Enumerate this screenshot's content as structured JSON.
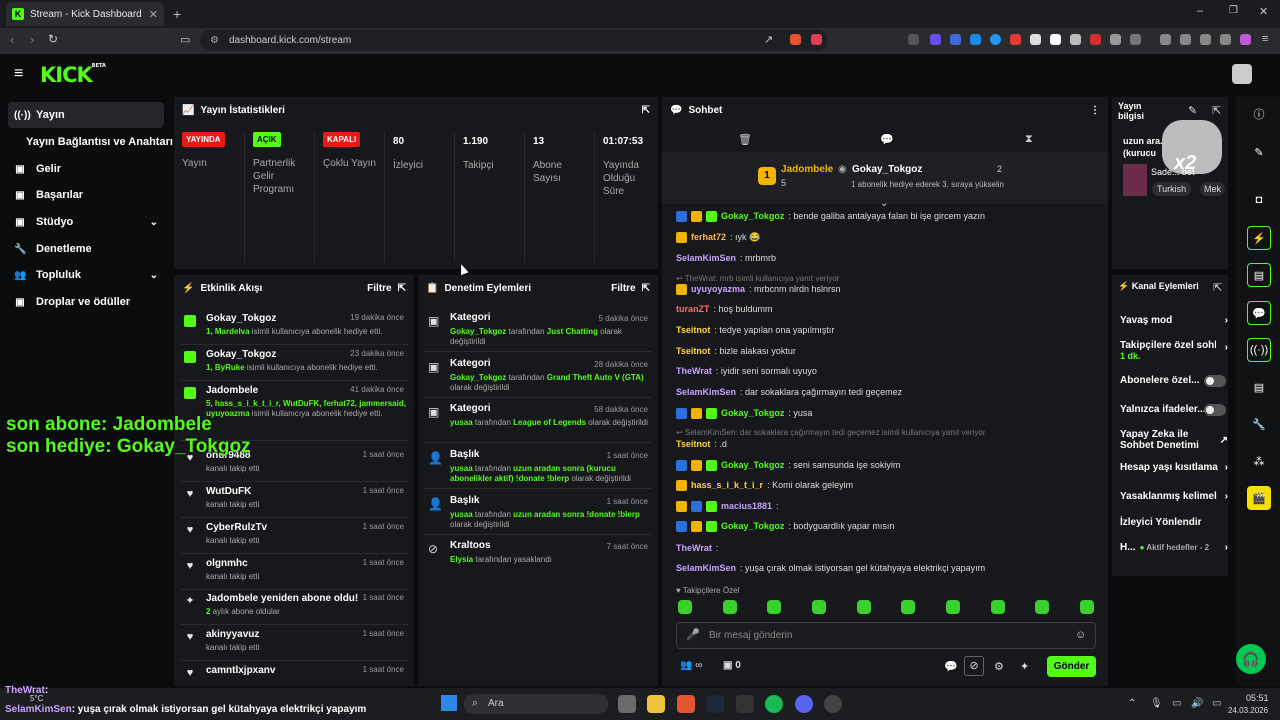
{
  "browser": {
    "tab_title": "Stream - Kick Dashboard",
    "url": "dashboard.kick.com/stream"
  },
  "brand": {
    "logo": "KICK",
    "beta": "BETA",
    "accent": "#53fc18"
  },
  "sidebar": {
    "items": [
      {
        "label": "Yayın",
        "icon": "broadcast-icon"
      },
      {
        "label": "Yayın Bağlantısı ve Anahtarı",
        "icon": ""
      },
      {
        "label": "Gelir",
        "icon": "dollar-icon"
      },
      {
        "label": "Başarılar",
        "icon": "trophy-icon"
      },
      {
        "label": "Stüdyo",
        "icon": "studio-icon"
      },
      {
        "label": "Denetleme",
        "icon": "wrench-icon"
      },
      {
        "label": "Topluluk",
        "icon": "users-icon"
      },
      {
        "label": "Droplar ve ödüller",
        "icon": "gift-icon"
      }
    ]
  },
  "stats": {
    "title": "Yayın İstatistikleri",
    "items": [
      {
        "badge": "YAYINDA",
        "label": "Yayın"
      },
      {
        "badge": "AÇIK",
        "label": "Partnerlik Gelir Programı"
      },
      {
        "badge": "KAPALI",
        "label": "Çoklu Yayın"
      },
      {
        "value": "80",
        "label": "İzleyici"
      },
      {
        "value": "1.190",
        "label": "Takipçi"
      },
      {
        "value": "13",
        "label": "Abone Sayısı"
      },
      {
        "value": "01:07:53",
        "label": "Yayında Olduğu Süre"
      }
    ]
  },
  "activity": {
    "title": "Etkinlik Akışı",
    "filter": "Filtre",
    "rows": [
      {
        "name": "Gokay_Tokgoz",
        "sub_hi": "1, Mardelva",
        "sub": " isimli kullanıcıya abonelik hediye etti.",
        "time": "19 dakika önce"
      },
      {
        "name": "Gokay_Tokgoz",
        "sub_hi": "1, ByRuke",
        "sub": " isimli kullanıcıya abonelik hediye etti.",
        "time": "23 dakika önce"
      },
      {
        "name": "Jadombele",
        "sub_hi": "5, hass_s_i_k_t_i_r, WutDuFK, ferhat72, jammersaid, uyuyoazma",
        "sub": " isimli kullanıcıya abonelik hediye etti.",
        "time": "41 dakika önce"
      },
      {
        "name": "onur9488",
        "sub_hi": "",
        "sub": "kanalı takip etti",
        "time": "1 saat önce"
      },
      {
        "name": "WutDuFK",
        "sub_hi": "",
        "sub": "kanalı takip etti",
        "time": "1 saat önce"
      },
      {
        "name": "CyberRulzTv",
        "sub_hi": "",
        "sub": "kanalı takip etti",
        "time": "1 saat önce"
      },
      {
        "name": "olgnmhc",
        "sub_hi": "",
        "sub": "kanalı takip etti",
        "time": "1 saat önce"
      },
      {
        "name": "Jadombele yeniden abone oldu!",
        "sub_hi": "2",
        "sub": " aylık abone oldular",
        "time": "1 saat önce"
      },
      {
        "name": "akinyyavuz",
        "sub_hi": "",
        "sub": "kanalı takip etti",
        "time": "1 saat önce"
      },
      {
        "name": "camntlxjpxanv",
        "sub_hi": "",
        "sub": "",
        "time": "1 saat önce"
      }
    ]
  },
  "moderation": {
    "title": "Denetim Eylemleri",
    "filter": "Filtre",
    "rows": [
      {
        "name": "Kategori",
        "actor": "Gokay_Tokgoz",
        "mid": " tarafından ",
        "target": "Just Chatting",
        "end": " olarak değiştirildi",
        "time": "5 dakika önce"
      },
      {
        "name": "Kategori",
        "actor": "Gokay_Tokgoz",
        "mid": " tarafından ",
        "target": "Grand Theft Auto V (GTA)",
        "end": " olarak değiştirildi",
        "time": "28 dakika önce"
      },
      {
        "name": "Kategori",
        "actor": "yusaa",
        "mid": " tarafından ",
        "target": "League of Legends",
        "end": " olarak değiştirildi",
        "time": "58 dakika önce"
      },
      {
        "name": "Başlık",
        "actor": "yusaa",
        "mid": " tarafından ",
        "target": "uzun aradan sonra (kurucu abonelikler aktif) !donate !blerp",
        "end": " olarak değiştirildi",
        "time": "1 saat önce"
      },
      {
        "name": "Başlık",
        "actor": "yusaa",
        "mid": " tarafından ",
        "target": "uzun aradan sonra !donate !blerp",
        "end": " olarak değiştirildi",
        "time": "1 saat önce"
      },
      {
        "name": "Kraltoos",
        "actor": "Elysia",
        "mid": " tarafından yasaklandı",
        "target": "",
        "end": "",
        "time": "7 saat önce"
      }
    ]
  },
  "chat": {
    "title": "Sohbet",
    "pinned": {
      "rank": "1",
      "user": "Jadombele",
      "count": "5",
      "gifter": "Gokay_Tokgoz",
      "gifter_count": "2",
      "note": "1 abonelik hediye ederek 3. sıraya yükselin"
    },
    "messages": [
      {
        "user": "Gokay_Tokgoz",
        "color": "#53fc18",
        "text": ": bende galiba antalyaya falan bi işe gircem yazın"
      },
      {
        "user": "ferhat72",
        "color": "#ffb84d",
        "text": ": ıyk 😂"
      },
      {
        "user": "SelamKimSen",
        "color": "#c8a2ff",
        "text": ": mrbmrb"
      },
      {
        "reply": "TheWrat: mrb isimli kullanıcıya yanıt veriyor"
      },
      {
        "user": "uyuyoyazma",
        "color": "#c8a2ff",
        "text": ": mrbcnm nlrdn hslnrsn"
      },
      {
        "user": "turanZT",
        "color": "#ff6b6b",
        "text": ": hoş buldumm"
      },
      {
        "user": "Tseitnot",
        "color": "#ffd23d",
        "text": ": tedye yapılan ona yapılmıştır"
      },
      {
        "user": "Tseitnot",
        "color": "#ffd23d",
        "text": ": bizle alakası yoktur"
      },
      {
        "user": "TheWrat",
        "color": "#c8a2ff",
        "text": ": iyidir seni sormalı uyuyo"
      },
      {
        "user": "SelamKimSen",
        "color": "#c8a2ff",
        "text": ": dar sokaklara çağırmayın tedi geçemez"
      },
      {
        "user": "Gokay_Tokgoz",
        "color": "#53fc18",
        "text": ": yusa"
      },
      {
        "reply": "SelamKimSen: dar sokaklara çağırmayın tedi geçemez isimli kullanıcıya yanıt veriyor"
      },
      {
        "user": "Tseitnot",
        "color": "#ffd23d",
        "text": ": .d"
      },
      {
        "user": "Gokay_Tokgoz",
        "color": "#53fc18",
        "text": ": seni samsunda işe sokiyim"
      },
      {
        "user": "hass_s_i_k_t_i_r",
        "color": "#ffd23d",
        "text": ": Komi olarak geleyim"
      },
      {
        "user": "macius1881",
        "color": "#c8a2ff",
        "text": ":"
      },
      {
        "user": "Gokay_Tokgoz",
        "color": "#53fc18",
        "text": ": bodyguardlık yapar mısın"
      },
      {
        "user": "TheWrat",
        "color": "#c8a2ff",
        "text": ":"
      },
      {
        "user": "SelamKimSen",
        "color": "#c8a2ff",
        "text": ": yuşa çırak olmak istiyorsan gel kütahyaya elektrikçi yapayım"
      }
    ],
    "followers_only": "Takipçilere Özel",
    "placeholder": "Bir mesaj gönderin",
    "send": "Gönder",
    "count_a": "∞",
    "count_b": "0"
  },
  "stream_info": {
    "title": "Yayın bilgisi",
    "stream_title": "uzun ara... (kurucu",
    "category": "Sade... bet",
    "tags": [
      "Turkish",
      "Mek"
    ],
    "overlay": "x2"
  },
  "channel_actions": {
    "title": "Kanal Eylemleri",
    "items": [
      {
        "label": "Yavaş mod",
        "type": "chevron"
      },
      {
        "label": "Takipçilere özel sohb",
        "sub": "1 dk.",
        "type": "chevron"
      },
      {
        "label": "Abonelere özel...",
        "type": "toggle"
      },
      {
        "label": "Yalnızca ifadeler...",
        "type": "toggle"
      },
      {
        "label": "Yapay Zeka ile Sohbet Denetimi",
        "type": "external"
      },
      {
        "label": "Hesap yaşı kısıtlama",
        "type": "chevron"
      },
      {
        "label": "Yasaklanmış kelimel",
        "type": "chevron"
      },
      {
        "label": "İzleyici Yönlendir",
        "type": "none"
      },
      {
        "label": "H...",
        "sub": "Aktif hedefler - 2",
        "type": "chevron"
      }
    ]
  },
  "overlay_text": {
    "line1": "son abone: Jadombele",
    "line2": "son hediye: Gokay_Tokgoz"
  },
  "bottom_chat": [
    {
      "user": "TheWrat",
      "text": ":"
    },
    {
      "user": "SelamKimSen",
      "text": ": yuşa çırak olmak istiyorsan gel kütahyaya elektrikçi yapayım"
    }
  ],
  "taskbar": {
    "search": "Ara",
    "weather": "5°C",
    "time": "05:51",
    "date": "24.03.2026"
  }
}
